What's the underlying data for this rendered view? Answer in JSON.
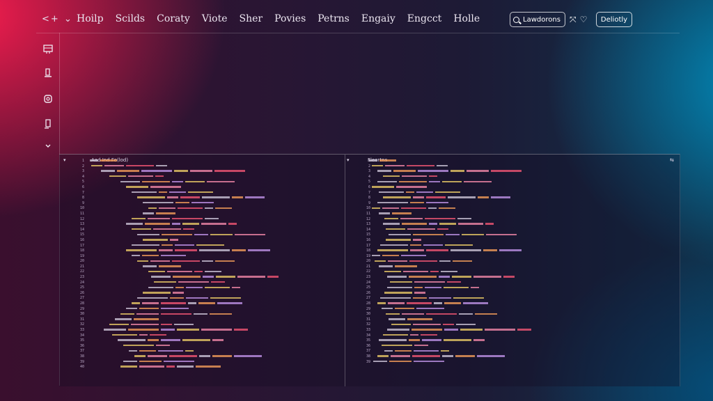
{
  "topbar": {
    "nav_back": "<",
    "nav_forward": "+",
    "nav_chevron": "⌄",
    "menu": [
      "Hoilp",
      "Scilds",
      "Coraty",
      "Viote",
      "Sher",
      "Povies",
      "Petrns",
      "Engaiy",
      "Engcct",
      "Holle"
    ],
    "search_label": "Lawdorons",
    "deploy_label": "Deliotly"
  },
  "sidebar": {
    "icons": [
      "dashboard-icon",
      "document-icon",
      "settings-icon",
      "file-icon",
      "chevron-down-icon"
    ]
  },
  "left_panel": {
    "header": "Aad Ind Fo(lod)",
    "start_line": 1,
    "line_count": 40
  },
  "right_panel": {
    "header": "Fleortns",
    "start_line": 1,
    "line_count": 39
  },
  "colors": {
    "accent_red": "#ff1e50",
    "accent_teal": "#0096c8",
    "code_red": "#ff5a78",
    "code_yellow": "#f5d46a",
    "code_purple": "#c89af2"
  }
}
